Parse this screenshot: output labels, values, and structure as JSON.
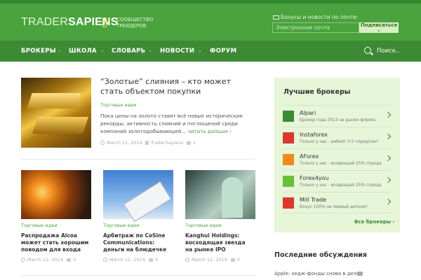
{
  "header": {
    "logo_light": "TRADER",
    "logo_bold": "SAPIENS",
    "tagline": "СООБЩЕСТВО ТРЕЙДЕРОВ",
    "subscribe_label": "Бонусы и новости по почте:",
    "email_placeholder": "Электронная почта",
    "subscribe_button": "Подписаться ›"
  },
  "nav": {
    "items": [
      "БРОКЕРЫ",
      "ШКОЛА",
      "СЛОВАРЬ",
      "НОВОСТИ",
      "ФОРУМ"
    ],
    "search_label": "Поиск.."
  },
  "featured": {
    "title": "“Золотые” слияния – кто может стать объектом покупки",
    "category": "Торговые идеи",
    "description": "Пока цены на золото ставят всё новые исторические рекорды, активность слияний и поглощений среди компаний золотодобывающей...",
    "more_link": "читать дальше ›",
    "date": "March 12, 2014",
    "author": "TraderSapiens",
    "comments": "1"
  },
  "cards": [
    {
      "category": "Торговые идеи",
      "title": "Распродажа Alcoa может стать хорошим поводом для входа",
      "date": "March 12, 2014",
      "comments": "0"
    },
    {
      "category": "Торговые идеи",
      "title": "Арбитраж по CoSine Communications: деньги на блюдечке",
      "date": "March 12, 2014",
      "comments": "0"
    },
    {
      "category": "Торговые идеи",
      "title": "Kanghui Holdings: восходящая звезда на рынке IPO",
      "date": "March 12, 2014",
      "comments": "0"
    }
  ],
  "sidebar": {
    "title": "Лучшие брокеры",
    "brokers": [
      {
        "name": "Alpari",
        "desc": "Брокер года 2013 на рынке форекс",
        "color": "#3d8a34"
      },
      {
        "name": "Instaforex",
        "desc": "Только у нас - рибейт 0.5 спредплат",
        "color": "#d93a2b"
      },
      {
        "name": "AForex",
        "desc": "Только у нас - возвращай 25% спреда",
        "color": "#f08a1a"
      },
      {
        "name": "Forex4you",
        "desc": "Только у нас - возвращай 25% спреда",
        "color": "#6abf3a"
      },
      {
        "name": "Mill Trade",
        "desc": "Бонус 100% на первый депозит",
        "color": "#d93a2b"
      }
    ],
    "all_brokers": "Все брокеры ›",
    "discussions_title": "Последние обсуждения",
    "discussion_item": "Apple: хедж-фонды снова в деле"
  },
  "colors": {
    "header_green": "#4aa33e",
    "nav_green": "#3d8a34",
    "sidebar_bg": "#e7f5d9",
    "link_green": "#4aa33e"
  }
}
